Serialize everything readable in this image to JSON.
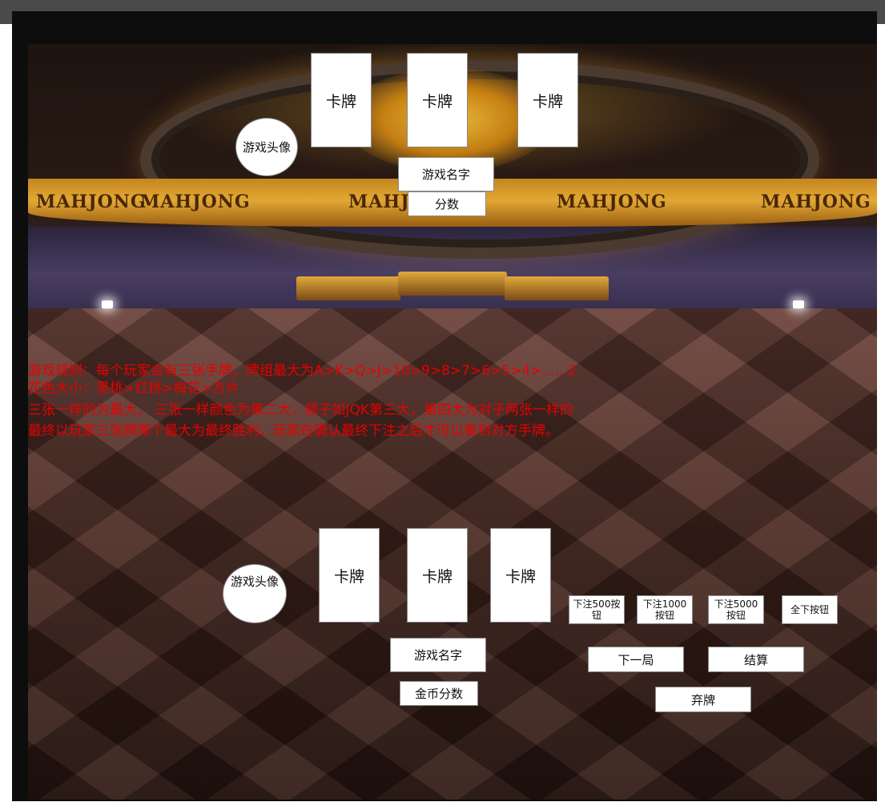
{
  "opponent": {
    "avatar_label": "游戏头像",
    "cards": [
      "卡牌",
      "卡牌",
      "卡牌"
    ],
    "name_label": "游戏名字",
    "score_label": "分数"
  },
  "rules": {
    "line1": "游戏规则：每个玩家会有三张手牌，牌组最大为A>K>Q>J>10>9>8>7>6>5>4>......2",
    "line2": "花色大小：黑桃>红桃>梅花>方片",
    "line3": "三张一样的为最大， 三张一样颜色为第二大，顺子如JQK第三大，第四大为对子两张一样的",
    "line4": "最终以玩家三张牌哪个最大为最终胜利，玩家在确认最终下注之后才可以看到对方手牌。"
  },
  "player": {
    "avatar_label": "游戏头像",
    "cards": [
      "卡牌",
      "卡牌",
      "卡牌"
    ],
    "name_label": "游戏名字",
    "coins_label": "金币分数"
  },
  "controls": {
    "bet500": "下注500按钮",
    "bet1000": "下注1000按钮",
    "bet5000": "下注5000按钮",
    "allin": "全下按钮",
    "next_round": "下一局",
    "settle": "结算",
    "fold": "弃牌"
  },
  "background": {
    "banner_text": "MAHJONG"
  }
}
